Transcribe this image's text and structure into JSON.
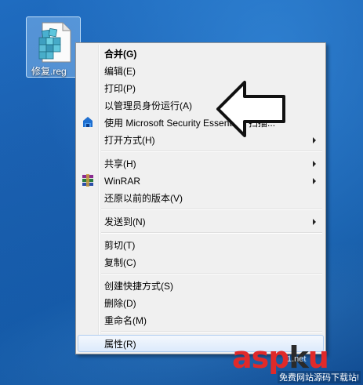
{
  "desktop": {
    "file": {
      "label": "修复.reg",
      "icon": "registry-file-icon"
    }
  },
  "menu": {
    "items": [
      {
        "label": "合并(G)",
        "bold": true
      },
      {
        "label": "编辑(E)"
      },
      {
        "label": "打印(P)"
      },
      {
        "label": "以管理员身份运行(A)"
      },
      {
        "label": "使用 Microsoft Security Essentials 扫描...",
        "icon": "security-essentials-icon"
      },
      {
        "label": "打开方式(H)",
        "submenu": true
      },
      {
        "label": "共享(H)",
        "submenu": true
      },
      {
        "label": "WinRAR",
        "icon": "winrar-icon",
        "submenu": true
      },
      {
        "label": "还原以前的版本(V)"
      },
      {
        "label": "发送到(N)",
        "submenu": true
      },
      {
        "label": "剪切(T)"
      },
      {
        "label": "复制(C)"
      },
      {
        "label": "创建快捷方式(S)"
      },
      {
        "label": "删除(D)"
      },
      {
        "label": "重命名(M)"
      },
      {
        "label": "属性(R)",
        "highlighted": true
      }
    ]
  },
  "annotation": {
    "icon": "left-arrow-icon"
  },
  "watermark": {
    "text_red_1": "asp",
    "text_dark": "k",
    "text_red_2": "u",
    "sub": "1.net",
    "caption": "免费网站源码下载站!"
  },
  "colors": {
    "menu_bg": "#f0f0f0",
    "highlight_border": "#aeccf0",
    "desktop": "#1b60b0",
    "watermark_red": "#e02a2a"
  }
}
